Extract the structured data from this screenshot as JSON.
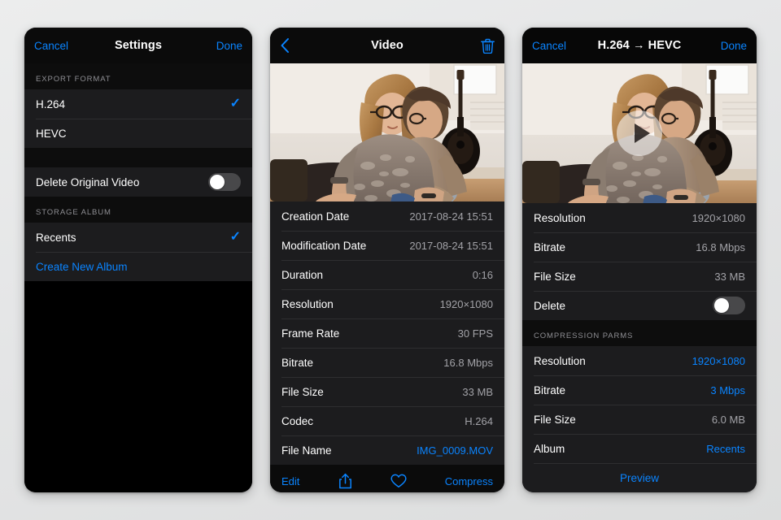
{
  "panel1": {
    "nav": {
      "cancel": "Cancel",
      "title": "Settings",
      "done": "Done"
    },
    "sections": [
      {
        "header": "EXPORT FORMAT",
        "rows": [
          {
            "label": "H.264",
            "checked": true
          },
          {
            "label": "HEVC",
            "checked": false
          }
        ]
      },
      {
        "header": "",
        "rows": [
          {
            "label": "Delete Original Video",
            "toggle": "off"
          }
        ]
      },
      {
        "header": "STORAGE ALBUM",
        "rows": [
          {
            "label": "Recents",
            "checked": true
          },
          {
            "label": "Create New Album",
            "link": true
          }
        ]
      }
    ]
  },
  "panel2": {
    "nav": {
      "back_icon": "chevron-left-icon",
      "title": "Video",
      "delete_icon": "trash-icon"
    },
    "photo_alt": "couple embracing on sofa with guitar",
    "rows": [
      {
        "label": "Creation Date",
        "value": "2017-08-24  15:51"
      },
      {
        "label": "Modification Date",
        "value": "2017-08-24  15:51"
      },
      {
        "label": "Duration",
        "value": "0:16"
      },
      {
        "label": "Resolution",
        "value": "1920×1080"
      },
      {
        "label": "Frame Rate",
        "value": "30 FPS"
      },
      {
        "label": "Bitrate",
        "value": "16.8 Mbps"
      },
      {
        "label": "File Size",
        "value": "33 MB"
      },
      {
        "label": "Codec",
        "value": "H.264"
      },
      {
        "label": "File Name",
        "value": "IMG_0009.MOV",
        "value_blue": true
      }
    ],
    "toolbar": {
      "edit": "Edit",
      "share_icon": "share-icon",
      "favorite_icon": "heart-icon",
      "compress": "Compress"
    }
  },
  "panel3": {
    "nav": {
      "cancel": "Cancel",
      "title": "H.264 → HEVC",
      "done": "Done"
    },
    "photo_alt": "couple embracing on sofa with guitar",
    "play_icon": "play-icon",
    "source_rows": [
      {
        "label": "Resolution",
        "value": "1920×1080"
      },
      {
        "label": "Bitrate",
        "value": "16.8 Mbps"
      },
      {
        "label": "File Size",
        "value": "33 MB"
      },
      {
        "label": "Delete",
        "toggle": "off"
      }
    ],
    "params_header": "COMPRESSION PARMS",
    "param_rows": [
      {
        "label": "Resolution",
        "value": "1920×1080",
        "value_blue": true
      },
      {
        "label": "Bitrate",
        "value": "3 Mbps",
        "value_blue": true
      },
      {
        "label": "File Size",
        "value": "6.0 MB"
      },
      {
        "label": "Album",
        "value": "Recents",
        "value_blue": true
      }
    ],
    "preview": "Preview"
  },
  "colors": {
    "accent": "#0a84ff",
    "row_bg": "#1c1c1e",
    "page_bg": "#e7e8e8"
  }
}
